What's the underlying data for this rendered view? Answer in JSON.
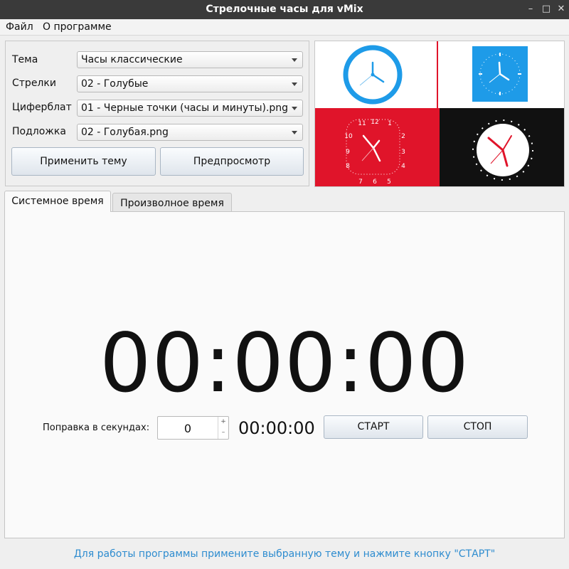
{
  "window": {
    "title": "Стрелочные часы для vMix"
  },
  "menu": {
    "file": "Файл",
    "about": "О программе"
  },
  "settings": {
    "theme_label": "Тема",
    "theme_value": "Часы классические",
    "hands_label": "Стрелки",
    "hands_value": "02 - Голубые",
    "dial_label": "Циферблат",
    "dial_value": "01 - Черные точки (часы и минуты).png",
    "bg_label": "Подложка",
    "bg_value": "02 - Голубая.png",
    "apply_button": "Применить тему",
    "preview_button": "Предпросмотр"
  },
  "previews": {
    "colors": {
      "blue": "#1e9be8",
      "red": "#e0142a",
      "black": "#111111",
      "white": "#ffffff"
    },
    "red_dial_numbers": [
      "12",
      "1",
      "2",
      "3",
      "4",
      "5",
      "6",
      "7",
      "8",
      "9",
      "10",
      "11"
    ]
  },
  "tabs": {
    "system": "Системное время",
    "custom": "Произволное время"
  },
  "main": {
    "big_time": "00:00:00",
    "correction_label": "Поправка в секундах:",
    "correction_value": "0",
    "small_time": "00:00:00",
    "start_button": "СТАРТ",
    "stop_button": "СТОП"
  },
  "status": {
    "text": "Для работы программы примените выбранную тему и нажмите кнопку \"СТАРТ\""
  }
}
